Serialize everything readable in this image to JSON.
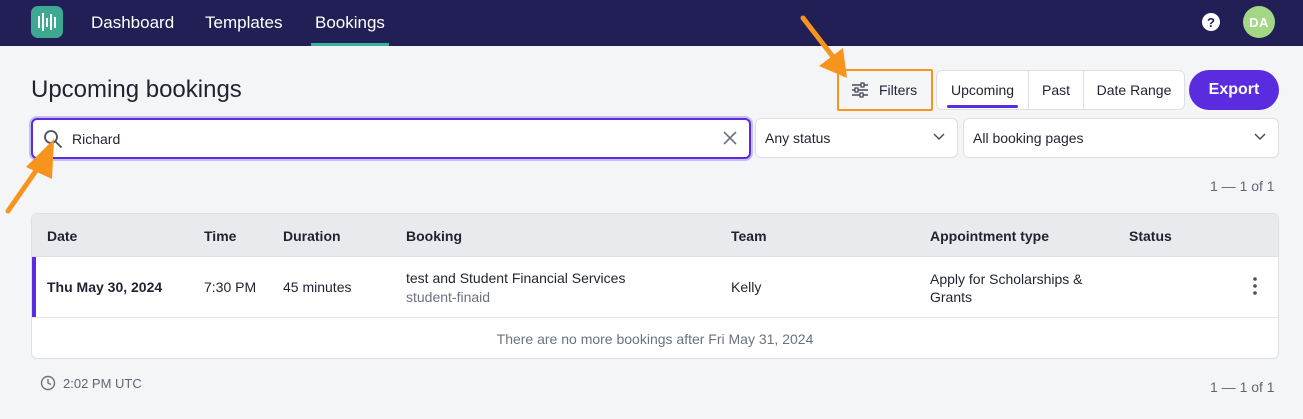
{
  "nav": {
    "items": [
      {
        "label": "Dashboard"
      },
      {
        "label": "Templates"
      },
      {
        "label": "Bookings"
      }
    ],
    "help_glyph": "?",
    "avatar_initials": "DA"
  },
  "page": {
    "title": "Upcoming bookings"
  },
  "toolbar": {
    "filters_label": "Filters",
    "segments": [
      {
        "label": "Upcoming",
        "active": true
      },
      {
        "label": "Past",
        "active": false
      },
      {
        "label": "Date Range",
        "active": false
      }
    ],
    "export_label": "Export"
  },
  "search": {
    "value": "Richard"
  },
  "selects": {
    "status": "Any status",
    "booking_pages": "All booking pages"
  },
  "pager": {
    "top": "1 — 1 of 1",
    "bottom": "1 — 1 of 1"
  },
  "table": {
    "columns": [
      "Date",
      "Time",
      "Duration",
      "Booking",
      "Team",
      "Appointment type",
      "Status"
    ],
    "rows": [
      {
        "date": "Thu May 30, 2024",
        "time": "7:30 PM",
        "duration": "45 minutes",
        "booking_title": "test and Student Financial Services",
        "booking_sub": "student-finaid",
        "team": "Kelly",
        "appointment_type": "Apply for Scholarships & Grants",
        "status": ""
      }
    ],
    "footer_note": "There are no more bookings after Fri May 31, 2024"
  },
  "footer": {
    "time": "2:02 PM UTC"
  },
  "colors": {
    "nav_bg": "#211f55",
    "accent": "#5b2be0",
    "highlight": "#f7941d",
    "logo_bg": "#3ea992",
    "avatar_bg": "#a4d785"
  }
}
